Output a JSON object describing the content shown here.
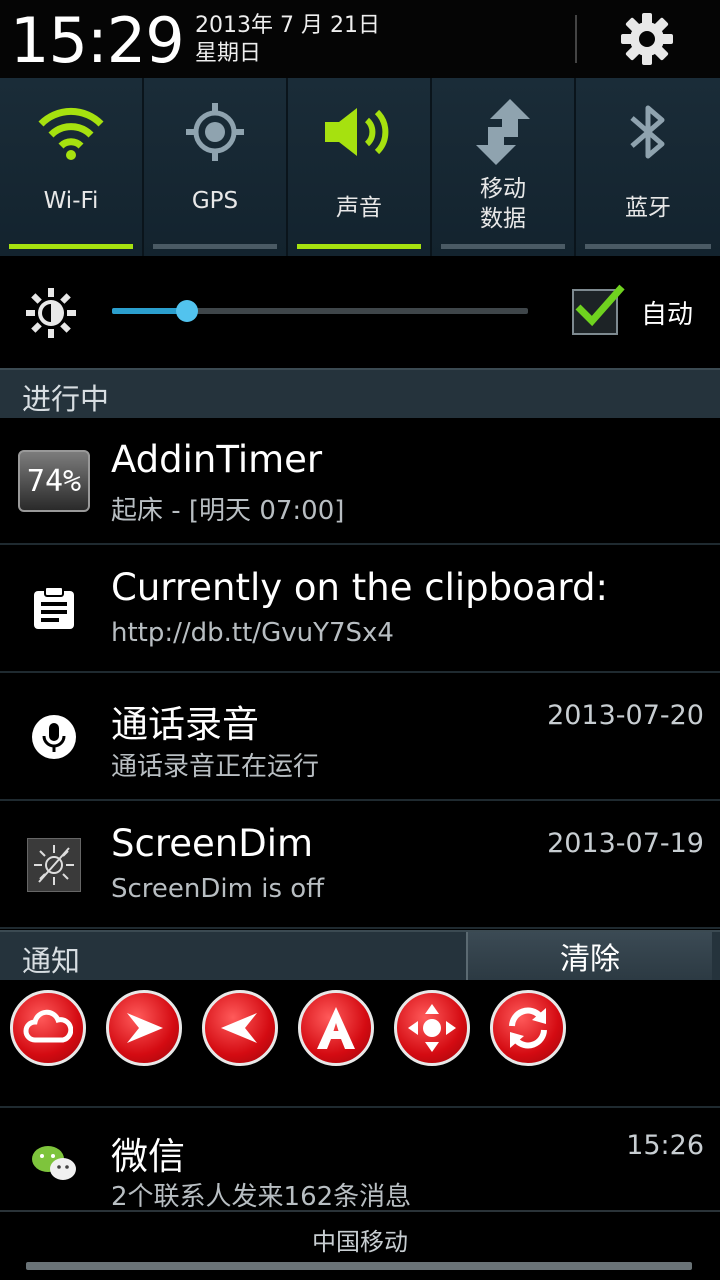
{
  "header": {
    "time": "15:29",
    "date_line": "2013年 7 月 21日",
    "weekday": "星期日"
  },
  "toggles": [
    {
      "label": "Wi-Fi",
      "icon": "wifi-icon",
      "active": true
    },
    {
      "label": "GPS",
      "icon": "gps-icon",
      "active": false
    },
    {
      "label": "声音",
      "icon": "sound-icon",
      "active": true
    },
    {
      "label_line1": "移动",
      "label_line2": "数据",
      "icon": "mobile-data-icon",
      "active": false
    },
    {
      "label": "蓝牙",
      "icon": "bluetooth-icon",
      "active": false
    }
  ],
  "brightness": {
    "level": 0.18,
    "auto_checked": true,
    "auto_label": "自动"
  },
  "ongoing": {
    "title": "进行中",
    "items": [
      {
        "title": "AddinTimer",
        "subtitle": "起床 - [明天 07:00]",
        "icon_text": "74%",
        "time": ""
      },
      {
        "title": "Currently on the clipboard:",
        "subtitle": "http://db.tt/GvuY7Sx4",
        "time": ""
      },
      {
        "title": "通话录音",
        "subtitle": "通话录音正在运行",
        "time": "2013-07-20"
      },
      {
        "title": "ScreenDim",
        "subtitle": "ScreenDim is off",
        "time": "2013-07-19"
      }
    ]
  },
  "notifications": {
    "title": "通知",
    "clear_label": "清除",
    "apps": [
      "cloud-icon",
      "arrow-right-icon",
      "arrow-left-icon",
      "letter-a-icon",
      "dpad-icon",
      "sync-icon"
    ],
    "wechat": {
      "title": "微信",
      "subtitle": "2个联系人发来162条消息",
      "time": "15:26"
    }
  },
  "footer": {
    "carrier": "中国移动"
  },
  "colors": {
    "accent_green": "#a6e10f",
    "slider_blue": "#2b9fce",
    "app_red": "#d40b12"
  }
}
